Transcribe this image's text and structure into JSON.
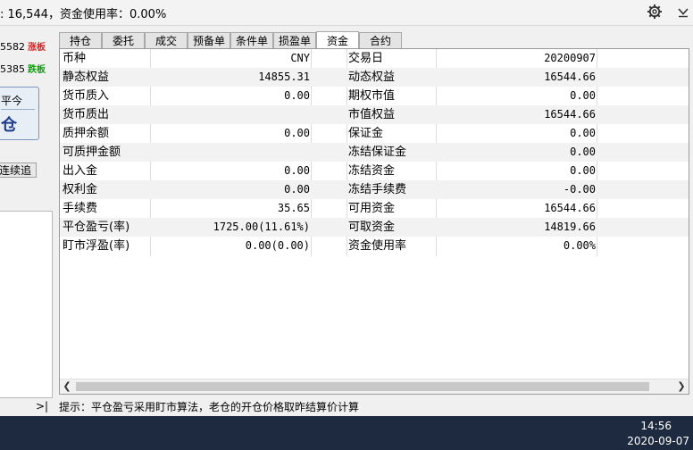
{
  "topbar": {
    "summary": ": 16,544，资金使用率：0.00%",
    "settings_icon": "gear-icon",
    "dropdown_icon": "chevron-down-icon"
  },
  "left": {
    "rows": [
      {
        "code": "5582",
        "badge": "涨板"
      },
      {
        "code": "5385",
        "badge": "跌板"
      }
    ],
    "order_top": "平今",
    "order_bottom": "仓",
    "continue_btn": "连续追"
  },
  "tabs": [
    "持仓",
    "委托",
    "成交",
    "预备单",
    "条件单",
    "损盈单",
    "资金",
    "合约"
  ],
  "active_tab": 6,
  "table": {
    "rows": [
      {
        "l1": "币种",
        "v1": "CNY",
        "l2": "交易日",
        "v2": "20200907"
      },
      {
        "l1": "静态权益",
        "v1": "14855.31",
        "l2": "动态权益",
        "v2": "16544.66"
      },
      {
        "l1": "货币质入",
        "v1": "0.00",
        "l2": "期权市值",
        "v2": "0.00"
      },
      {
        "l1": "货币质出",
        "v1": "",
        "l2": "市值权益",
        "v2": "16544.66"
      },
      {
        "l1": "质押余额",
        "v1": "0.00",
        "l2": "保证金",
        "v2": "0.00"
      },
      {
        "l1": "可质押金额",
        "v1": "",
        "l2": "冻结保证金",
        "v2": "0.00"
      },
      {
        "l1": "出入金",
        "v1": "0.00",
        "l2": "冻结资金",
        "v2": "0.00"
      },
      {
        "l1": "权利金",
        "v1": "0.00",
        "l2": "冻结手续费",
        "v2": "-0.00"
      },
      {
        "l1": "手续费",
        "v1": "35.65",
        "l2": "可用资金",
        "v2": "16544.66"
      },
      {
        "l1": "平仓盈亏(率)",
        "v1": "1725.00(11.61%)",
        "l2": "可取资金",
        "v2": "14819.66"
      },
      {
        "l1": "盯市浮盈(率)",
        "v1": "0.00(0.00)",
        "l2": "资金使用率",
        "v2": "0.00%"
      }
    ]
  },
  "hint": "提示：平仓盈亏采用盯市算法，老仓的开仓价格取昨结算价计算",
  "collapse_label": ">|",
  "taskbar": {
    "time": "14:56",
    "date": "2020-09-07"
  }
}
